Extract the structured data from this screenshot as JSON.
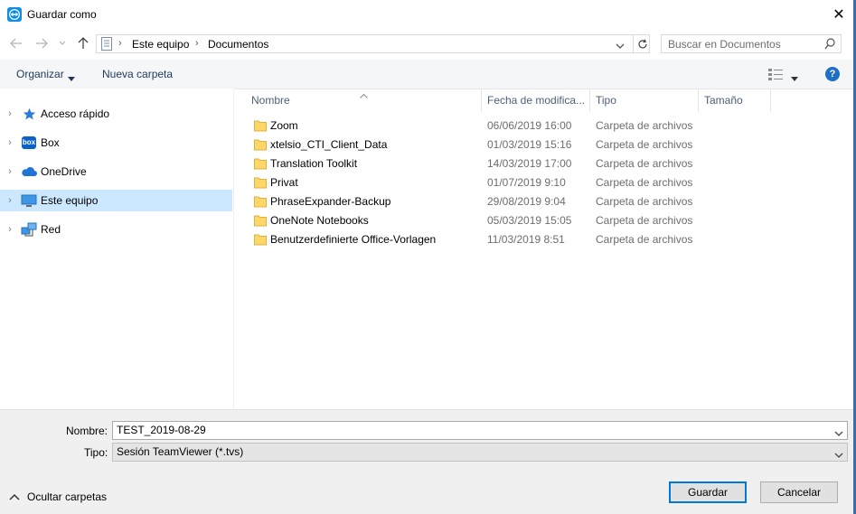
{
  "window": {
    "title": "Guardar como",
    "close_glyph": "✕"
  },
  "address": {
    "breadcrumb": [
      "Este equipo",
      "Documentos"
    ],
    "search_placeholder": "Buscar en Documentos"
  },
  "toolbar": {
    "organize": "Organizar",
    "new_folder": "Nueva carpeta",
    "help": "?"
  },
  "nav": {
    "items": [
      {
        "label": "Acceso rápido",
        "icon": "star-icon"
      },
      {
        "label": "Box",
        "icon": "box-icon"
      },
      {
        "label": "OneDrive",
        "icon": "cloud-icon"
      },
      {
        "label": "Este equipo",
        "icon": "computer-icon",
        "selected": true
      },
      {
        "label": "Red",
        "icon": "network-icon"
      }
    ]
  },
  "columns": {
    "name": "Nombre",
    "date": "Fecha de modifica...",
    "type": "Tipo",
    "size": "Tamaño"
  },
  "files": [
    {
      "name": "Zoom",
      "date": "06/06/2019 16:00",
      "type": "Carpeta de archivos"
    },
    {
      "name": "xtelsio_CTI_Client_Data",
      "date": "01/03/2019 15:16",
      "type": "Carpeta de archivos"
    },
    {
      "name": "Translation Toolkit",
      "date": "14/03/2019 17:00",
      "type": "Carpeta de archivos"
    },
    {
      "name": "Privat",
      "date": "01/07/2019 9:10",
      "type": "Carpeta de archivos"
    },
    {
      "name": "PhraseExpander-Backup",
      "date": "29/08/2019 9:04",
      "type": "Carpeta de archivos"
    },
    {
      "name": "OneNote Notebooks",
      "date": "05/03/2019 15:05",
      "type": "Carpeta de archivos"
    },
    {
      "name": "Benutzerdefinierte Office-Vorlagen",
      "date": "11/03/2019 8:51",
      "type": "Carpeta de archivos"
    }
  ],
  "form": {
    "name_label": "Nombre:",
    "name_value": "TEST_2019-08-29",
    "type_label": "Tipo:",
    "type_value": "Sesión TeamViewer (*.tvs)"
  },
  "footer": {
    "hide_folders": "Ocultar carpetas",
    "save": "Guardar",
    "cancel": "Cancelar"
  },
  "colors": {
    "accent": "#0078d7",
    "selection": "#cce8ff",
    "folder": "#ffd766"
  }
}
